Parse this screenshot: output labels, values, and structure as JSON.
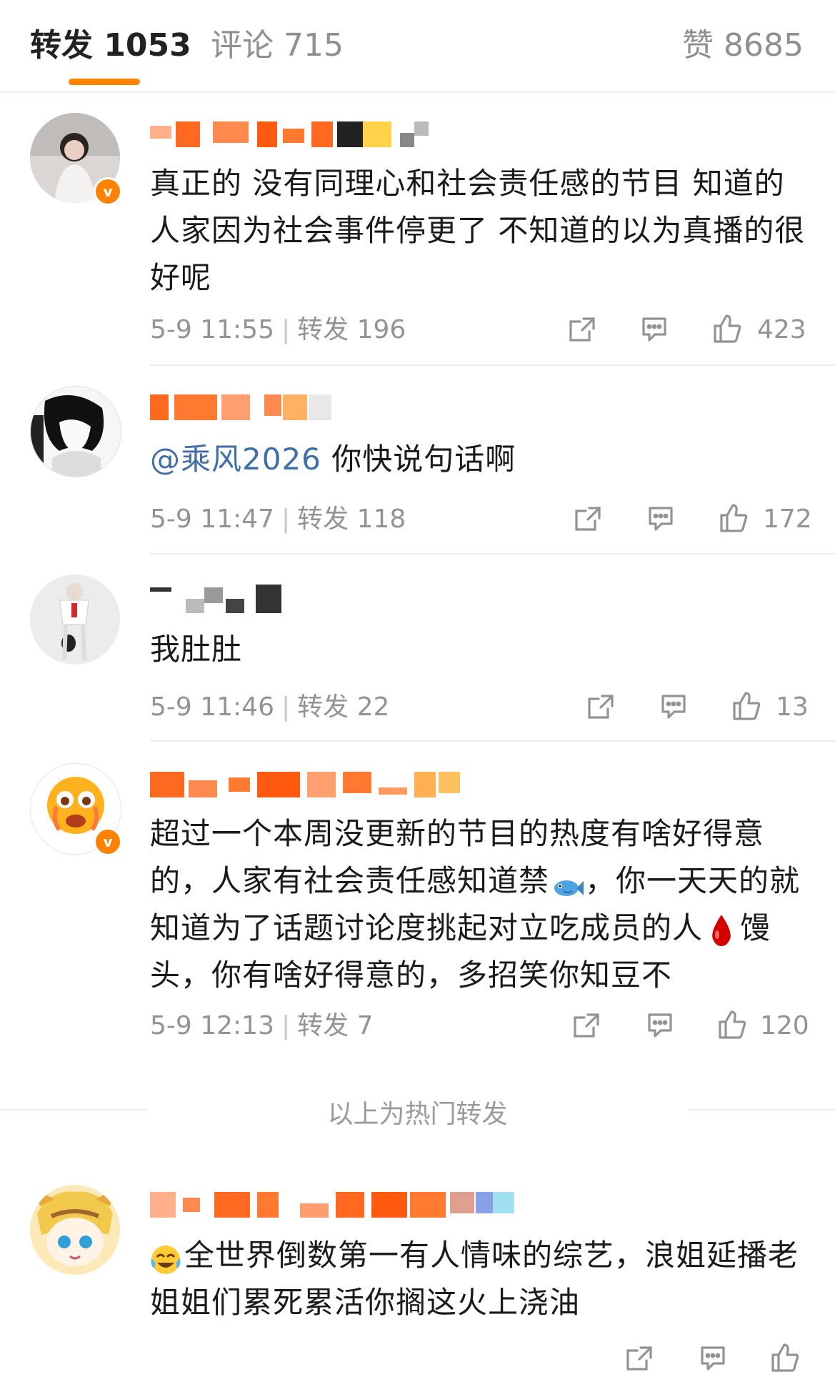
{
  "tabs": {
    "repost_label": "转发 1053",
    "comment_label": "评论 715",
    "like_label": "赞 8685"
  },
  "colors": {
    "accent": "#ff8200",
    "mention": "#3f6ea8",
    "meta": "#939393"
  },
  "comments": [
    {
      "text": "真正的 没有同理心和社会责任感的节目 知道的人家因为社会事件停更了 不知道的以为真播的很好呢",
      "time": "5-9 11:55",
      "repost": "转发 196",
      "likes": "423",
      "verified": true
    },
    {
      "mention": "@乘风2026",
      "text": " 你快说句话啊",
      "time": "5-9 11:47",
      "repost": "转发 118",
      "likes": "172",
      "verified": false
    },
    {
      "text": "我肚肚",
      "time": "5-9 11:46",
      "repost": "转发 22",
      "likes": "13",
      "verified": false
    },
    {
      "text_part1": "超过一个本周没更新的节目的热度有啥好得意的，人家有社会责任感知道禁",
      "text_part2": "，你一天天的就知道为了话题讨论度挑起对立吃成员的人",
      "text_part3": "馒头，你有啥好得意的，多招笑你知豆不",
      "time": "5-9 12:13",
      "repost": "转发 7",
      "likes": "120",
      "verified": true
    },
    {
      "text": "全世界倒数第一有人情味的综艺，浪姐延播老姐姐们累死累活你搁这火上浇油",
      "verified": false
    }
  ],
  "hot_separator": "以上为热门转发",
  "icons": [
    "share-icon",
    "comment-icon",
    "like-icon",
    "verified-badge-icon",
    "fish-emoji",
    "blood-drop-emoji",
    "laugh-cry-emoji"
  ]
}
